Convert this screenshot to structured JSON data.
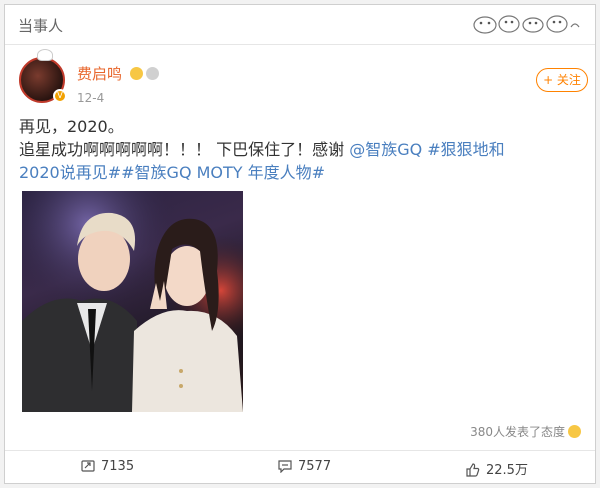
{
  "header": {
    "title": "当事人"
  },
  "post": {
    "username": "费启鸣",
    "date": "12-4",
    "follow_label": "+ 关注",
    "text_line1": "再见，2020。",
    "text_line2_a": "追星成功啊啊啊啊啊！！！ 下巴保住了！感谢 ",
    "mention": "@智族GQ",
    "hashtag1_a": " #狠狠地和",
    "hashtag1_b": "2020说再见#",
    "hashtag2": "#智族GQ MOTY 年度人物#",
    "like_summary": "380人发表了态度"
  },
  "actions": {
    "repost": "7135",
    "comment": "7577",
    "like": "22.5万"
  },
  "icons": {
    "repost": "repost-icon",
    "comment": "comment-icon",
    "like": "thumbs-up-icon",
    "smile": "smile-emoji-icon"
  },
  "colors": {
    "username": "#e8672d",
    "link": "#4a7fbf",
    "follow": "#ff8200"
  }
}
